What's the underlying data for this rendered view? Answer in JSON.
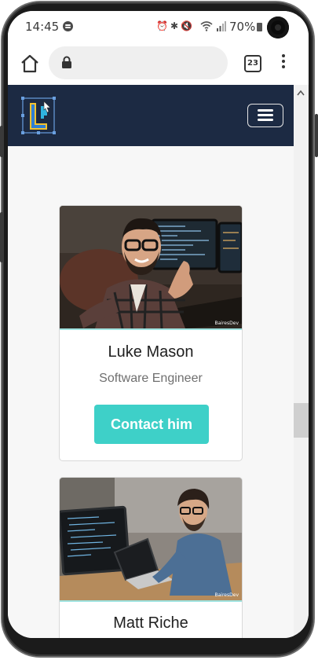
{
  "status_bar": {
    "time": "14:45",
    "battery": "70%",
    "icons": [
      "alarm-icon",
      "bluetooth-icon",
      "mute-icon",
      "wifi-icon",
      "signal-icon"
    ]
  },
  "browser": {
    "url": "",
    "tab_count": "23"
  },
  "site": {
    "brand_colors": {
      "navbar": "#1c2a43",
      "accent": "#3ed0c8"
    }
  },
  "cards": [
    {
      "name": "Luke Mason",
      "role": "Software Engineer",
      "button": "Contact him",
      "photo_watermark": "BairesDev"
    },
    {
      "name": "Matt Riche",
      "photo_watermark": "BairesDev"
    }
  ]
}
